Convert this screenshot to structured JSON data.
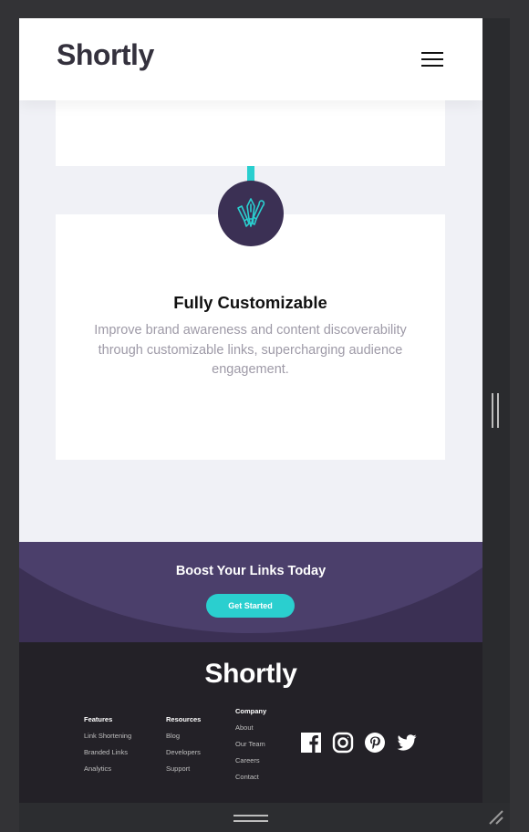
{
  "header": {
    "logo": "Shortly"
  },
  "icons": {
    "menu": "hamburger-menu-icon",
    "feature": "pen-brush-tools-icon",
    "facebook": "facebook-icon",
    "instagram": "instagram-icon",
    "pinterest": "pinterest-icon",
    "twitter": "twitter-icon"
  },
  "feature_card": {
    "title": "Fully Customizable",
    "description": "Improve brand awareness and content discoverability through customizable links, supercharging audience engagement."
  },
  "boost": {
    "title": "Boost Your Links Today",
    "button_label": "Get Started"
  },
  "footer": {
    "logo": "Shortly",
    "columns": [
      {
        "heading": "Features",
        "links": [
          "Link Shortening",
          "Branded Links",
          "Analytics"
        ]
      },
      {
        "heading": "Resources",
        "links": [
          "Blog",
          "Developers",
          "Support"
        ]
      },
      {
        "heading": "Company",
        "links": [
          "About",
          "Our Team",
          "Careers",
          "Contact"
        ]
      }
    ]
  },
  "colors": {
    "accent": "#2acfcf",
    "dark_violet": "#3b3054",
    "footer_bg": "#232127",
    "page_bg": "#f0f1f6"
  }
}
